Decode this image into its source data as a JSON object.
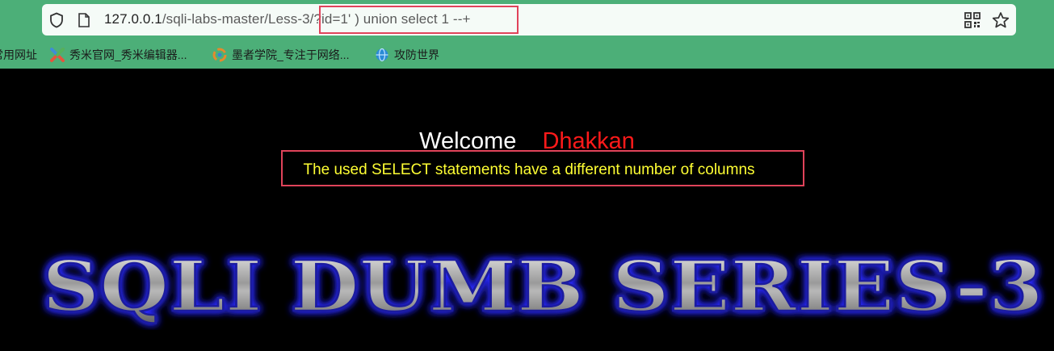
{
  "browser": {
    "url_host": "127.0.0.1",
    "url_path": "/sqli-labs-master/Less-3/?id=1' ) union select 1 --+",
    "icons": [
      "shield-icon",
      "page-icon",
      "qr-code-icon",
      "star-icon"
    ]
  },
  "bookmarks": [
    {
      "label": "常用网址",
      "icon": "none"
    },
    {
      "label": "秀米官网_秀米编辑器...",
      "icon": "xiumi-icon"
    },
    {
      "label": "墨者学院_专注于网络...",
      "icon": "mozhe-icon"
    },
    {
      "label": "攻防世界",
      "icon": "globe-icon"
    }
  ],
  "page": {
    "welcome_label": "Welcome",
    "welcome_name": "Dhakkan",
    "error_message": "The used SELECT statements have a different number of columns",
    "banner_title": "SQLI DUMB SERIES-3"
  },
  "colors": {
    "chrome_green": "#4caf78",
    "highlight_red": "#e0435a",
    "error_yellow": "#ffff33",
    "name_red": "#ff1a1a"
  }
}
